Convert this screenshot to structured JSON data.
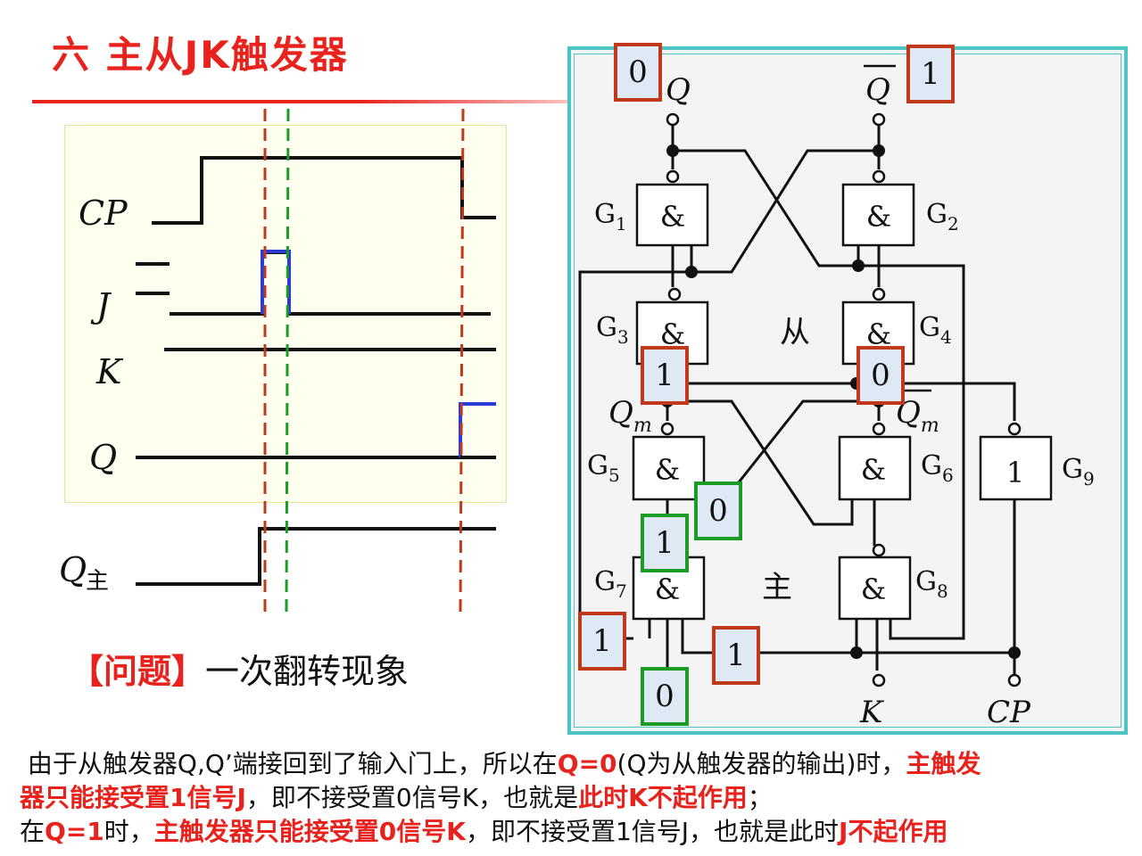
{
  "slide": {
    "title": "六  主从JK触发器",
    "question_bracket": "【问题】",
    "question_text": "一次翻转现象"
  },
  "timing": {
    "labels": {
      "cp": "CP",
      "j": "J",
      "k": "K",
      "q": "Q",
      "qm": "Q",
      "qm_sub": "主"
    }
  },
  "circuit": {
    "gates": {
      "g1": {
        "name": "G",
        "sub": "1",
        "symbol": "&"
      },
      "g2": {
        "name": "G",
        "sub": "2",
        "symbol": "&"
      },
      "g3": {
        "name": "G",
        "sub": "3",
        "symbol": "&"
      },
      "g4": {
        "name": "G",
        "sub": "4",
        "symbol": "&"
      },
      "g5": {
        "name": "G",
        "sub": "5",
        "symbol": "&"
      },
      "g6": {
        "name": "G",
        "sub": "6",
        "symbol": "&"
      },
      "g7": {
        "name": "G",
        "sub": "7",
        "symbol": "&"
      },
      "g8": {
        "name": "G",
        "sub": "8",
        "symbol": "&"
      },
      "g9": {
        "name": "G",
        "sub": "9",
        "symbol": "1"
      }
    },
    "signals": {
      "q": "Q",
      "q_bar": "Q",
      "qm": "Q",
      "qm_sub": "m",
      "qm_bar": "Q",
      "qm_bar_sub": "m",
      "k": "K",
      "cp": "CP"
    },
    "sections": {
      "slave": "从",
      "master": "主"
    },
    "values": {
      "q_out": "0",
      "q_bar_out": "1",
      "qm": "1",
      "qm_bar": "0",
      "g5_in": "0",
      "g7_in_top": "1",
      "g7_in_left": "1",
      "g7_in_right": "1",
      "g7_in_bottom": "0"
    },
    "colors": {
      "value_red_border": "#c0391b",
      "value_green_border": "#1a9c26",
      "frame": "#4cc4c4"
    }
  },
  "explanation": {
    "p1_a": "由于从触发器Q,Q’端接回到了输入门上，所以在",
    "p1_b": "Q=0",
    "p1_c": "(Q为从触发器的输出)时，",
    "p1_d": "主触发",
    "p2_a": "器只能接受置1信号J",
    "p2_b": "，即不接受置0信号K，也就是",
    "p2_c": "此时K不起作用",
    "p2_d": "；",
    "p3_a": "在",
    "p3_b": "Q=1",
    "p3_c": "时，",
    "p3_d": "主触发器只能接受置0信号K",
    "p3_e": "，即不接受置1信号J，也就是此时",
    "p3_f": "J不起作用"
  }
}
